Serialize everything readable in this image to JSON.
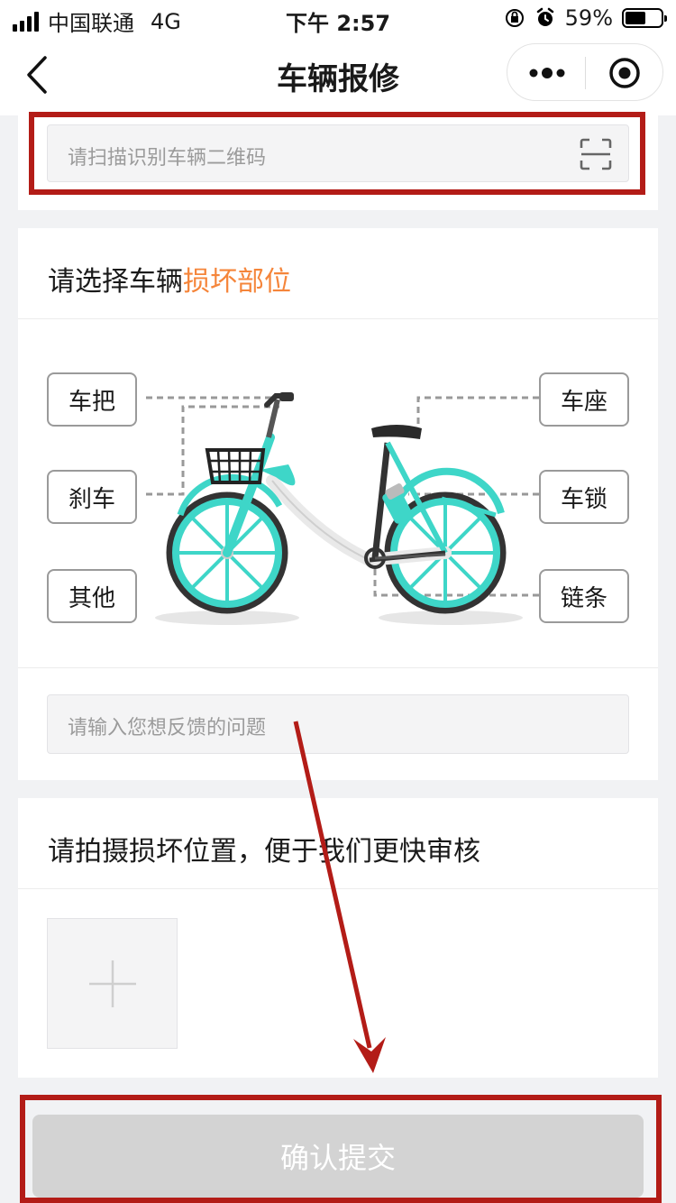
{
  "status_bar": {
    "carrier": "中国联通",
    "network": "4G",
    "time": "下午 2:57",
    "battery": "59%",
    "battery_level": 0.59
  },
  "nav": {
    "title": "车辆报修"
  },
  "scan": {
    "placeholder": "请扫描识别车辆二维码"
  },
  "parts_section": {
    "title_prefix": "请选择车辆",
    "title_highlight": "损坏部位",
    "left_parts": [
      "车把",
      "刹车",
      "其他"
    ],
    "right_parts": [
      "车座",
      "车锁",
      "链条"
    ]
  },
  "feedback": {
    "placeholder": "请输入您想反馈的问题"
  },
  "photo_section": {
    "title": "请拍摄损坏位置，便于我们更快审核"
  },
  "submit": {
    "label": "确认提交"
  },
  "colors": {
    "accent": "#f5853a",
    "bike_teal": "#3ed6c8",
    "annotation_red": "#b31c17",
    "disabled_button": "#d3d3d3"
  }
}
